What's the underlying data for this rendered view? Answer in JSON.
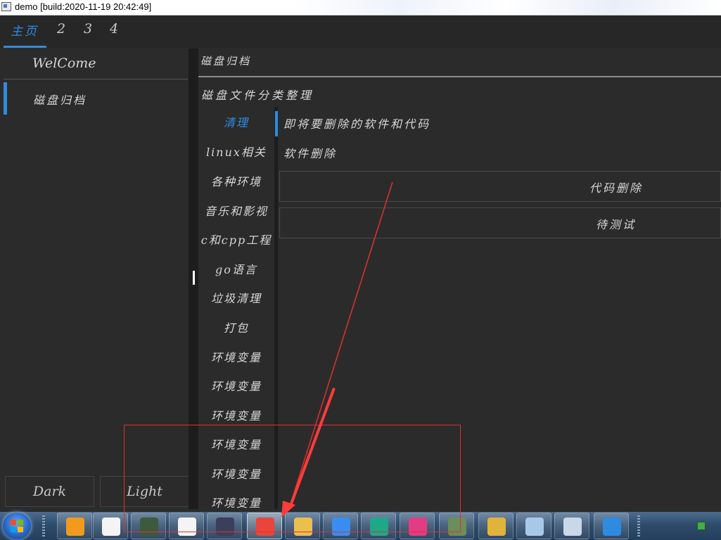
{
  "window": {
    "title": "demo [build:2020-11-19 20:42:49]"
  },
  "tabs": [
    {
      "label": "主页",
      "active": true
    },
    {
      "label": "2"
    },
    {
      "label": "3"
    },
    {
      "label": "4"
    }
  ],
  "nav": {
    "items": [
      {
        "label": "WelCome"
      },
      {
        "label": "磁盘归档",
        "active": true
      }
    ],
    "theme_buttons": {
      "dark": "Dark",
      "light": "Light"
    }
  },
  "content": {
    "header": "磁盘归档",
    "section_title": "磁盘文件分类整理",
    "categories": [
      {
        "label": "清理",
        "active": true
      },
      {
        "label": "linux相关"
      },
      {
        "label": "各种环境"
      },
      {
        "label": "音乐和影视"
      },
      {
        "label": "c和cpp工程"
      },
      {
        "label": "go语言"
      },
      {
        "label": "垃圾清理"
      },
      {
        "label": "打包"
      },
      {
        "label": "环境变量"
      },
      {
        "label": "环境变量"
      },
      {
        "label": "环境变量"
      },
      {
        "label": "环境变量"
      },
      {
        "label": "环境变量"
      },
      {
        "label": "环境变量"
      }
    ],
    "sub_title": "即将要删除的软件和代码",
    "soft_delete": "软件删除",
    "rows": [
      {
        "label": "代码删除"
      },
      {
        "label": "待测试"
      }
    ]
  },
  "taskbar": {
    "apps": [
      {
        "icon": "search-magnifier-icon",
        "color": "#f29a1d"
      },
      {
        "icon": "blank-document-icon",
        "color": "#f4f4f4"
      },
      {
        "icon": "network-tool-icon",
        "color": "#3c5a3c"
      },
      {
        "icon": "blank-document-icon",
        "color": "#f4f4f4"
      },
      {
        "icon": "goland-icon",
        "color": "#3b3f5c"
      },
      {
        "icon": "puzzle-app-icon",
        "color": "#e8453c",
        "active": true
      },
      {
        "icon": "file-explorer-icon",
        "color": "#e9c04c"
      },
      {
        "icon": "media-player-icon",
        "color": "#3a8df0"
      },
      {
        "icon": "upwork-icon",
        "color": "#1ea888"
      },
      {
        "icon": "terminal-arrows-icon",
        "color": "#e43c84"
      },
      {
        "icon": "monitor-app-icon",
        "color": "#6b8e5a"
      },
      {
        "icon": "chrome-icon",
        "color": "#e0b43a"
      },
      {
        "icon": "notepad-icon",
        "color": "#a8c8e8"
      },
      {
        "icon": "window-app-icon",
        "color": "#c8d8e8"
      },
      {
        "icon": "phone-app-icon",
        "color": "#2f8be0"
      }
    ]
  },
  "colors": {
    "accent": "#2f8be0",
    "background": "#2b2b2b",
    "annotation": "#e03030"
  }
}
